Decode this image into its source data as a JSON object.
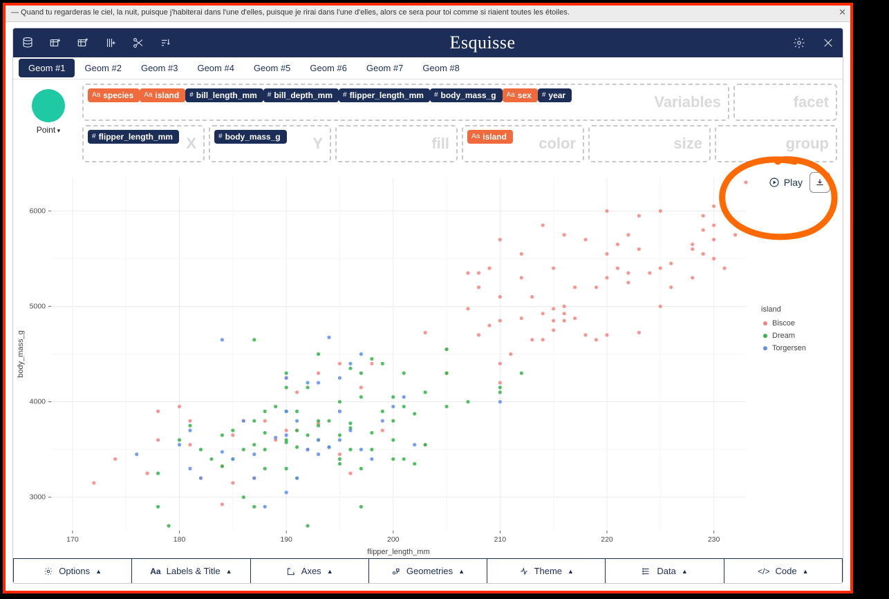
{
  "quote": "— Quand tu regarderas le ciel, la nuit, puisque j'habiterai dans l'une d'elles, puisque je rirai dans l'une d'elles, alors ce sera pour toi comme si riaient toutes les étoiles.",
  "brand": "Esquisse",
  "tabs": [
    "Geom #1",
    "Geom #2",
    "Geom #3",
    "Geom #4",
    "Geom #5",
    "Geom #6",
    "Geom #7",
    "Geom #8"
  ],
  "active_tab": 0,
  "geom_picker_label": "Point",
  "available_vars": [
    {
      "name": "species",
      "kind": "Aa",
      "color": "orange"
    },
    {
      "name": "island",
      "kind": "Aa",
      "color": "orange"
    },
    {
      "name": "bill_length_mm",
      "kind": "#",
      "color": "blue"
    },
    {
      "name": "bill_depth_mm",
      "kind": "#",
      "color": "blue"
    },
    {
      "name": "flipper_length_mm",
      "kind": "#",
      "color": "blue"
    },
    {
      "name": "body_mass_g",
      "kind": "#",
      "color": "blue"
    },
    {
      "name": "sex",
      "kind": "Aa",
      "color": "orange"
    },
    {
      "name": "year",
      "kind": "#",
      "color": "blue"
    }
  ],
  "zone_labels": {
    "variables": "Variables",
    "facet": "facet",
    "x": "X",
    "y": "Y",
    "fill": "fill",
    "color": "color",
    "size": "size",
    "group": "group"
  },
  "mappings": {
    "x": {
      "name": "flipper_length_mm",
      "kind": "#",
      "color": "blue"
    },
    "y": {
      "name": "body_mass_g",
      "kind": "#",
      "color": "blue"
    },
    "color": {
      "name": "island",
      "kind": "Aa",
      "color": "orange"
    }
  },
  "play_label": "Play",
  "bottom": [
    {
      "label": "Options",
      "icon": "gear"
    },
    {
      "label": "Labels & Title",
      "icon": "Aa"
    },
    {
      "label": "Axes",
      "icon": "axes"
    },
    {
      "label": "Geometries",
      "icon": "geom"
    },
    {
      "label": "Theme",
      "icon": "theme"
    },
    {
      "label": "Data",
      "icon": "data"
    },
    {
      "label": "Code",
      "icon": "code"
    }
  ],
  "legend": {
    "title": "island",
    "items": [
      {
        "label": "Biscoe",
        "color": "#f7837c"
      },
      {
        "label": "Dream",
        "color": "#34b44a"
      },
      {
        "label": "Torgersen",
        "color": "#5b8def"
      }
    ]
  },
  "chart_data": {
    "type": "scatter",
    "xlabel": "flipper_length_mm",
    "ylabel": "body_mass_g",
    "xlim": [
      168,
      233
    ],
    "ylim": [
      2650,
      6350
    ],
    "xticks": [
      170,
      180,
      190,
      200,
      210,
      220,
      230
    ],
    "yticks": [
      3000,
      4000,
      5000,
      6000
    ],
    "series": [
      {
        "name": "Biscoe",
        "color": "#f7837c",
        "points": [
          [
            174,
            3400
          ],
          [
            172,
            3150
          ],
          [
            177,
            3250
          ],
          [
            178,
            3900
          ],
          [
            178,
            3600
          ],
          [
            180,
            3950
          ],
          [
            181,
            3800
          ],
          [
            181,
            3550
          ],
          [
            182,
            3200
          ],
          [
            184,
            3325
          ],
          [
            184,
            2925
          ],
          [
            185,
            3650
          ],
          [
            185,
            3150
          ],
          [
            186,
            3800
          ],
          [
            187,
            3200
          ],
          [
            188,
            3800
          ],
          [
            189,
            3600
          ],
          [
            190,
            3700
          ],
          [
            190,
            4250
          ],
          [
            191,
            3700
          ],
          [
            191,
            4100
          ],
          [
            192,
            3500
          ],
          [
            193,
            3775
          ],
          [
            193,
            4300
          ],
          [
            195,
            3450
          ],
          [
            195,
            4400
          ],
          [
            196,
            3250
          ],
          [
            197,
            4150
          ],
          [
            198,
            4400
          ],
          [
            199,
            3700
          ],
          [
            203,
            4725
          ],
          [
            205,
            4300
          ],
          [
            203,
            3550
          ],
          [
            205,
            4550
          ],
          [
            207,
            5350
          ],
          [
            207,
            4975
          ],
          [
            208,
            4700
          ],
          [
            208,
            5350
          ],
          [
            208,
            5200
          ],
          [
            209,
            4800
          ],
          [
            209,
            5400
          ],
          [
            210,
            4200
          ],
          [
            210,
            4850
          ],
          [
            210,
            5100
          ],
          [
            210,
            4400
          ],
          [
            210,
            5700
          ],
          [
            211,
            4500
          ],
          [
            212,
            4875
          ],
          [
            212,
            5300
          ],
          [
            212,
            5550
          ],
          [
            213,
            4650
          ],
          [
            213,
            5100
          ],
          [
            214,
            4925
          ],
          [
            214,
            4650
          ],
          [
            214,
            5850
          ],
          [
            215,
            4850
          ],
          [
            215,
            5400
          ],
          [
            215,
            4975
          ],
          [
            215,
            4750
          ],
          [
            216,
            4925
          ],
          [
            216,
            5000
          ],
          [
            216,
            4850
          ],
          [
            216,
            5750
          ],
          [
            217,
            4875
          ],
          [
            217,
            5200
          ],
          [
            218,
            4700
          ],
          [
            218,
            5700
          ],
          [
            219,
            5200
          ],
          [
            219,
            4650
          ],
          [
            220,
            4700
          ],
          [
            220,
            5550
          ],
          [
            220,
            5300
          ],
          [
            220,
            6000
          ],
          [
            221,
            5400
          ],
          [
            221,
            5650
          ],
          [
            222,
            5250
          ],
          [
            222,
            5750
          ],
          [
            222,
            5350
          ],
          [
            223,
            4725
          ],
          [
            223,
            5600
          ],
          [
            223,
            5950
          ],
          [
            224,
            5350
          ],
          [
            225,
            5400
          ],
          [
            225,
            6000
          ],
          [
            225,
            5000
          ],
          [
            226,
            5200
          ],
          [
            226,
            5450
          ],
          [
            228,
            5300
          ],
          [
            228,
            5600
          ],
          [
            228,
            5650
          ],
          [
            229,
            5550
          ],
          [
            229,
            5800
          ],
          [
            229,
            5950
          ],
          [
            230,
            5500
          ],
          [
            230,
            5700
          ],
          [
            230,
            5850
          ],
          [
            230,
            6050
          ],
          [
            231,
            5400
          ],
          [
            232,
            5750
          ],
          [
            233,
            6300
          ]
        ]
      },
      {
        "name": "Dream",
        "color": "#34b44a",
        "points": [
          [
            178,
            3250
          ],
          [
            178,
            2900
          ],
          [
            179,
            2700
          ],
          [
            180,
            3600
          ],
          [
            181,
            3750
          ],
          [
            182,
            3500
          ],
          [
            183,
            3400
          ],
          [
            184,
            3325
          ],
          [
            184,
            3650
          ],
          [
            185,
            3400
          ],
          [
            185,
            3700
          ],
          [
            186,
            3500
          ],
          [
            186,
            3000
          ],
          [
            187,
            3800
          ],
          [
            187,
            2900
          ],
          [
            187,
            3550
          ],
          [
            188,
            3500
          ],
          [
            188,
            3900
          ],
          [
            188,
            3300
          ],
          [
            188,
            3675
          ],
          [
            189,
            3950
          ],
          [
            190,
            3600
          ],
          [
            190,
            3300
          ],
          [
            190,
            3900
          ],
          [
            190,
            3575
          ],
          [
            190,
            4150
          ],
          [
            190,
            4300
          ],
          [
            191,
            3200
          ],
          [
            191,
            3525
          ],
          [
            191,
            3700
          ],
          [
            191,
            3900
          ],
          [
            192,
            3650
          ],
          [
            192,
            2700
          ],
          [
            192,
            4150
          ],
          [
            193,
            3750
          ],
          [
            193,
            3600
          ],
          [
            193,
            3800
          ],
          [
            193,
            4500
          ],
          [
            194,
            3800
          ],
          [
            194,
            3525
          ],
          [
            195,
            3400
          ],
          [
            195,
            3650
          ],
          [
            195,
            4000
          ],
          [
            195,
            3350
          ],
          [
            196,
            3725
          ],
          [
            196,
            3500
          ],
          [
            196,
            4350
          ],
          [
            196,
            3775
          ],
          [
            197,
            3300
          ],
          [
            197,
            4300
          ],
          [
            197,
            4050
          ],
          [
            197,
            2900
          ],
          [
            198,
            3675
          ],
          [
            198,
            4450
          ],
          [
            198,
            3500
          ],
          [
            199,
            3900
          ],
          [
            199,
            4400
          ],
          [
            200,
            3400
          ],
          [
            200,
            3800
          ],
          [
            200,
            4050
          ],
          [
            200,
            3600
          ],
          [
            201,
            4300
          ],
          [
            201,
            3950
          ],
          [
            201,
            3400
          ],
          [
            202,
            3875
          ],
          [
            202,
            3350
          ],
          [
            203,
            4100
          ],
          [
            203,
            3550
          ],
          [
            205,
            4550
          ],
          [
            205,
            3950
          ],
          [
            205,
            4300
          ],
          [
            207,
            4000
          ],
          [
            210,
            4150
          ],
          [
            210,
            4100
          ],
          [
            212,
            4300
          ],
          [
            187,
            4650
          ]
        ]
      },
      {
        "name": "Torgersen",
        "color": "#5b8def",
        "points": [
          [
            176,
            3450
          ],
          [
            180,
            3550
          ],
          [
            181,
            3300
          ],
          [
            181,
            3700
          ],
          [
            182,
            3200
          ],
          [
            184,
            3475
          ],
          [
            184,
            4650
          ],
          [
            185,
            3400
          ],
          [
            186,
            3800
          ],
          [
            187,
            3450
          ],
          [
            187,
            3200
          ],
          [
            188,
            2900
          ],
          [
            189,
            3625
          ],
          [
            190,
            3650
          ],
          [
            190,
            4250
          ],
          [
            190,
            3050
          ],
          [
            190,
            3900
          ],
          [
            191,
            3200
          ],
          [
            191,
            3800
          ],
          [
            192,
            3500
          ],
          [
            192,
            4200
          ],
          [
            193,
            4200
          ],
          [
            193,
            3450
          ],
          [
            193,
            3600
          ],
          [
            194,
            3525
          ],
          [
            194,
            4675
          ],
          [
            195,
            3600
          ],
          [
            195,
            4250
          ],
          [
            195,
            3900
          ],
          [
            196,
            4400
          ],
          [
            196,
            3700
          ],
          [
            197,
            3500
          ],
          [
            197,
            4500
          ],
          [
            198,
            3400
          ],
          [
            199,
            3800
          ],
          [
            200,
            3950
          ],
          [
            201,
            4050
          ],
          [
            202,
            3550
          ],
          [
            210,
            4000
          ]
        ]
      }
    ]
  }
}
